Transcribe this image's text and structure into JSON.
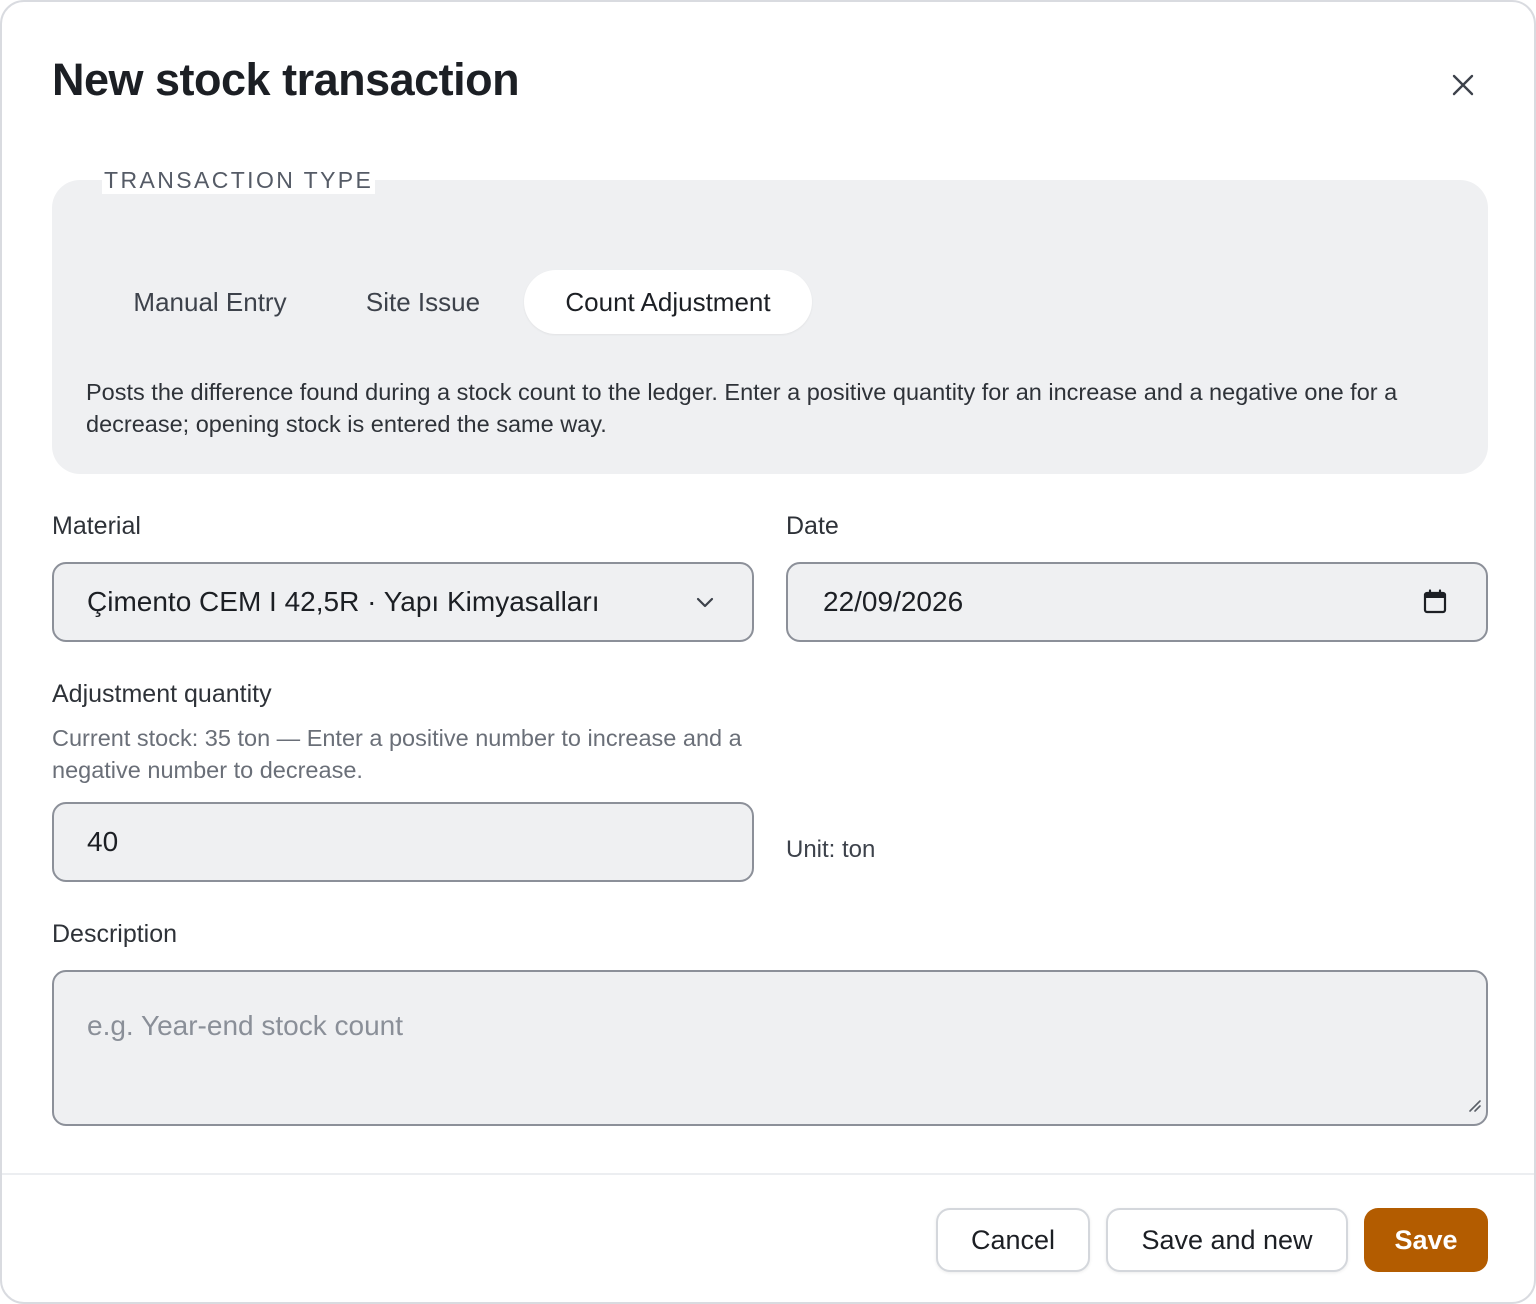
{
  "dialog": {
    "title": "New stock transaction"
  },
  "transaction_type": {
    "legend": "TRANSACTION TYPE",
    "options": [
      {
        "label": "Manual Entry",
        "selected": false
      },
      {
        "label": "Site Issue",
        "selected": false
      },
      {
        "label": "Count Adjustment",
        "selected": true
      }
    ],
    "description": "Posts the difference found during a stock count to the ledger. Enter a positive quantity for an increase and a negative one for a decrease; opening stock is entered the same way."
  },
  "form": {
    "material": {
      "label": "Material",
      "value": "Çimento CEM I 42,5R · Yapı Kimyasalları"
    },
    "date": {
      "label": "Date",
      "value": "22/09/2026"
    },
    "adjustment_quantity": {
      "label": "Adjustment quantity",
      "hint": "Current stock: 35 ton — Enter a positive number to increase and a negative number to decrease.",
      "value": "40",
      "unit_text": "Unit: ton"
    },
    "description": {
      "label": "Description",
      "placeholder": "e.g. Year-end stock count"
    }
  },
  "footer": {
    "cancel_label": "Cancel",
    "save_and_new_label": "Save and new",
    "save_label": "Save"
  },
  "colors": {
    "primary": "#b35c00",
    "panel_bg": "#eff0f2",
    "field_border": "#8c9099"
  },
  "icons": {
    "close": "close-icon",
    "material_dropdown": "chevron-down-icon",
    "date_picker": "calendar-icon",
    "textarea_resize": "resize-handle-icon"
  }
}
